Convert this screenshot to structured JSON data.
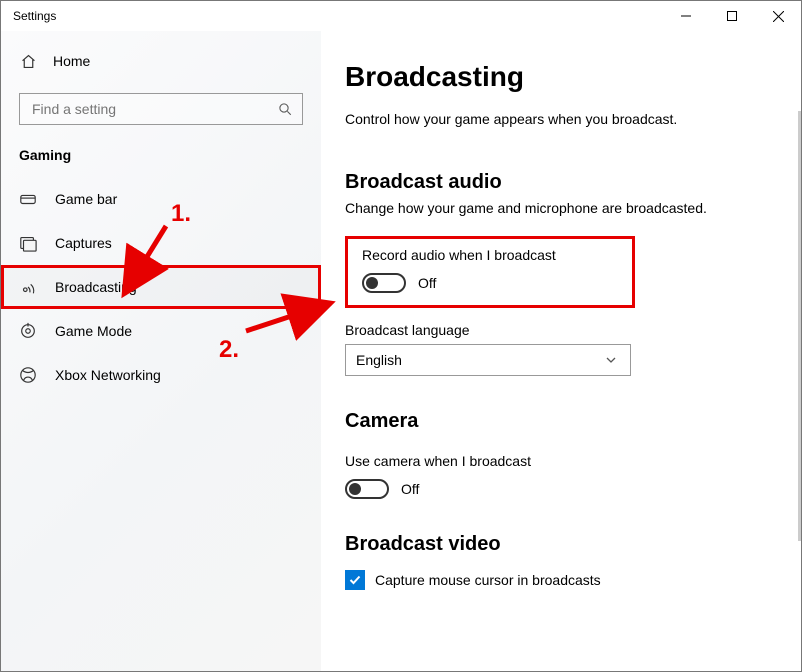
{
  "window": {
    "title": "Settings"
  },
  "sidebar": {
    "home_label": "Home",
    "search_placeholder": "Find a setting",
    "section": "Gaming",
    "items": [
      {
        "label": "Game bar"
      },
      {
        "label": "Captures"
      },
      {
        "label": "Broadcasting"
      },
      {
        "label": "Game Mode"
      },
      {
        "label": "Xbox Networking"
      }
    ]
  },
  "main": {
    "title": "Broadcasting",
    "desc": "Control how your game appears when you broadcast.",
    "audio": {
      "heading": "Broadcast audio",
      "desc": "Change how your game and microphone are broadcasted.",
      "record_label": "Record audio when I broadcast",
      "record_state": "Off",
      "lang_label": "Broadcast language",
      "lang_value": "English"
    },
    "camera": {
      "heading": "Camera",
      "use_label": "Use camera when I broadcast",
      "use_state": "Off"
    },
    "video": {
      "heading": "Broadcast video",
      "cursor_label": "Capture mouse cursor in broadcasts"
    }
  },
  "annotations": {
    "step1": "1.",
    "step2": "2.",
    "step1_color": "#e60000",
    "step2_color": "#e60000"
  }
}
